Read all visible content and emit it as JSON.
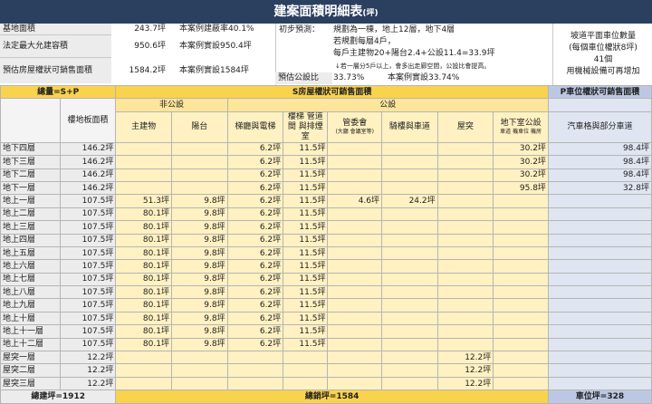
{
  "title": {
    "main": "建案面積明細表",
    "unit": "(坪)"
  },
  "info": {
    "land_label": "基地面積",
    "land_value": "243.7坪",
    "land_note": "本案例建蔽率40.1%",
    "far_label": "法定最大允建容積",
    "far_value": "950.6坪",
    "far_note": "本案例實設950.4坪",
    "sale_label": "預估房屋權狀可銷售面積",
    "sale_value": "1584.2坪",
    "sale_note": "本案例實設1584坪",
    "prelim_label": "初步預測：",
    "prelim_lines": [
      "規劃為一棟，地上12層，地下4層",
      "若規劃每層4戶，",
      "每戶主建物20+陽台2.4+公設11.4=33.9坪"
    ],
    "arrow_note": "↓若一層分5戶以上，會多出走廊空間，公設比會提高。",
    "share_label": "預估公設比",
    "share_value": "33.73%",
    "share_note": "本案例實設33.74%",
    "parking_lines": [
      "坡道平面車位數量",
      "(每個車位權狀8坪)",
      "41個",
      "用機械設備可再增加"
    ]
  },
  "headers": {
    "total_label": "總量=S+P",
    "s_label": "S房屋權狀可銷售面積",
    "p_label": "P車位權狀可銷售面積",
    "nonpublic": "非公設",
    "public": "公設",
    "floor_area": "樓地板面積",
    "main_bldg": "主建物",
    "balcony": "陽台",
    "stairs": "梯廳與電梯",
    "shaft": "樓梯 管道間 與排煙室",
    "mgmt": "管委會",
    "mgmt_sub": "(大廳 會議室等)",
    "arcade": "騎樓與車道",
    "roof": "屋突",
    "b_public": "地下室公設",
    "b_public_sub": "車道 機車位 機房",
    "p_col": "汽車格與部分車道"
  },
  "rows": [
    {
      "floor": "地下四層",
      "area": "146.2坪",
      "main": "",
      "bal": "",
      "stairs": "6.2坪",
      "shaft": "11.5坪",
      "mgmt": "",
      "arcade": "",
      "roof": "",
      "bpub": "30.2坪",
      "park": "98.4坪"
    },
    {
      "floor": "地下三層",
      "area": "146.2坪",
      "main": "",
      "bal": "",
      "stairs": "6.2坪",
      "shaft": "11.5坪",
      "mgmt": "",
      "arcade": "",
      "roof": "",
      "bpub": "30.2坪",
      "park": "98.4坪"
    },
    {
      "floor": "地下二層",
      "area": "146.2坪",
      "main": "",
      "bal": "",
      "stairs": "6.2坪",
      "shaft": "11.5坪",
      "mgmt": "",
      "arcade": "",
      "roof": "",
      "bpub": "30.2坪",
      "park": "98.4坪"
    },
    {
      "floor": "地下一層",
      "area": "146.2坪",
      "main": "",
      "bal": "",
      "stairs": "6.2坪",
      "shaft": "11.5坪",
      "mgmt": "",
      "arcade": "",
      "roof": "",
      "bpub": "95.8坪",
      "park": "32.8坪"
    },
    {
      "floor": "地上一層",
      "area": "107.5坪",
      "main": "51.3坪",
      "bal": "9.8坪",
      "stairs": "6.2坪",
      "shaft": "11.5坪",
      "mgmt": "4.6坪",
      "arcade": "24.2坪",
      "roof": "",
      "bpub": "",
      "park": ""
    },
    {
      "floor": "地上二層",
      "area": "107.5坪",
      "main": "80.1坪",
      "bal": "9.8坪",
      "stairs": "6.2坪",
      "shaft": "11.5坪",
      "mgmt": "",
      "arcade": "",
      "roof": "",
      "bpub": "",
      "park": ""
    },
    {
      "floor": "地上三層",
      "area": "107.5坪",
      "main": "80.1坪",
      "bal": "9.8坪",
      "stairs": "6.2坪",
      "shaft": "11.5坪",
      "mgmt": "",
      "arcade": "",
      "roof": "",
      "bpub": "",
      "park": ""
    },
    {
      "floor": "地上四層",
      "area": "107.5坪",
      "main": "80.1坪",
      "bal": "9.8坪",
      "stairs": "6.2坪",
      "shaft": "11.5坪",
      "mgmt": "",
      "arcade": "",
      "roof": "",
      "bpub": "",
      "park": ""
    },
    {
      "floor": "地上五層",
      "area": "107.5坪",
      "main": "80.1坪",
      "bal": "9.8坪",
      "stairs": "6.2坪",
      "shaft": "11.5坪",
      "mgmt": "",
      "arcade": "",
      "roof": "",
      "bpub": "",
      "park": ""
    },
    {
      "floor": "地上六層",
      "area": "107.5坪",
      "main": "80.1坪",
      "bal": "9.8坪",
      "stairs": "6.2坪",
      "shaft": "11.5坪",
      "mgmt": "",
      "arcade": "",
      "roof": "",
      "bpub": "",
      "park": ""
    },
    {
      "floor": "地上七層",
      "area": "107.5坪",
      "main": "80.1坪",
      "bal": "9.8坪",
      "stairs": "6.2坪",
      "shaft": "11.5坪",
      "mgmt": "",
      "arcade": "",
      "roof": "",
      "bpub": "",
      "park": ""
    },
    {
      "floor": "地上八層",
      "area": "107.5坪",
      "main": "80.1坪",
      "bal": "9.8坪",
      "stairs": "6.2坪",
      "shaft": "11.5坪",
      "mgmt": "",
      "arcade": "",
      "roof": "",
      "bpub": "",
      "park": ""
    },
    {
      "floor": "地上九層",
      "area": "107.5坪",
      "main": "80.1坪",
      "bal": "9.8坪",
      "stairs": "6.2坪",
      "shaft": "11.5坪",
      "mgmt": "",
      "arcade": "",
      "roof": "",
      "bpub": "",
      "park": ""
    },
    {
      "floor": "地上十層",
      "area": "107.5坪",
      "main": "80.1坪",
      "bal": "9.8坪",
      "stairs": "6.2坪",
      "shaft": "11.5坪",
      "mgmt": "",
      "arcade": "",
      "roof": "",
      "bpub": "",
      "park": ""
    },
    {
      "floor": "地上十一層",
      "area": "107.5坪",
      "main": "80.1坪",
      "bal": "9.8坪",
      "stairs": "6.2坪",
      "shaft": "11.5坪",
      "mgmt": "",
      "arcade": "",
      "roof": "",
      "bpub": "",
      "park": ""
    },
    {
      "floor": "地上十二層",
      "area": "107.5坪",
      "main": "80.1坪",
      "bal": "9.8坪",
      "stairs": "6.2坪",
      "shaft": "11.5坪",
      "mgmt": "",
      "arcade": "",
      "roof": "",
      "bpub": "",
      "park": ""
    },
    {
      "floor": "屋突一層",
      "area": "12.2坪",
      "main": "",
      "bal": "",
      "stairs": "",
      "shaft": "",
      "mgmt": "",
      "arcade": "",
      "roof": "12.2坪",
      "bpub": "",
      "park": ""
    },
    {
      "floor": "屋突二層",
      "area": "12.2坪",
      "main": "",
      "bal": "",
      "stairs": "",
      "shaft": "",
      "mgmt": "",
      "arcade": "",
      "roof": "12.2坪",
      "bpub": "",
      "park": ""
    },
    {
      "floor": "屋突三層",
      "area": "12.2坪",
      "main": "",
      "bal": "",
      "stairs": "",
      "shaft": "",
      "mgmt": "",
      "arcade": "",
      "roof": "12.2坪",
      "bpub": "",
      "park": ""
    }
  ],
  "footer": {
    "total": "總建坪=1912",
    "sale": "總銷坪=1584",
    "park": "車位坪=328"
  }
}
